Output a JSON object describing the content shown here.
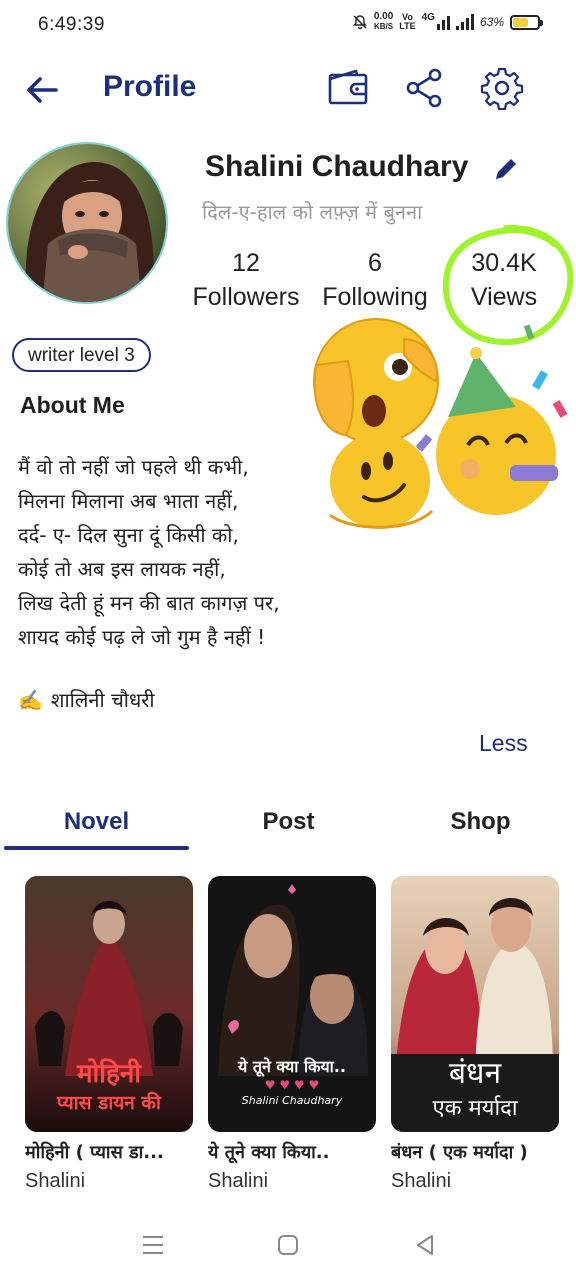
{
  "status_bar": {
    "time": "6:49:39",
    "net_speed_value": "0.00",
    "net_speed_unit": "KB/S",
    "volte_top": "Vo",
    "volte_bottom": "LTE",
    "network": "4G",
    "battery": "63%",
    "battery_level": 0.63
  },
  "header": {
    "title": "Profile",
    "back_icon": "arrow-left-icon",
    "wallet_icon": "wallet-icon",
    "share_icon": "share-icon",
    "settings_icon": "gear-icon"
  },
  "profile": {
    "name": "Shalini Chaudhary",
    "tagline": "दिल-ए-हाल को लफ़्ज़ में बुनना",
    "stats": [
      {
        "value": "12",
        "label": "Followers"
      },
      {
        "value": "6",
        "label": "Following"
      },
      {
        "value": "30.4K",
        "label": "Views"
      }
    ],
    "level": "writer level 3"
  },
  "about": {
    "title": "About Me",
    "lines": [
      "मैं वो तो नहीं जो पहले थी कभी,",
      "मिलना मिलाना अब भाता नहीं,",
      "दर्द- ए- दिल सुना दूं किसी को,",
      "कोई तो अब इस लायक नहीं,",
      "लिख देती हूं मन की बात कागज़ पर,",
      "शायद कोई पढ़ ले जो गुम है नहीं !"
    ],
    "signature_emoji": "✍️",
    "signature": "शालिनी चौधरी",
    "less_label": "Less"
  },
  "tabs": {
    "items": [
      "Novel",
      "Post",
      "Shop"
    ],
    "active": "Novel"
  },
  "books": [
    {
      "title": "मोहिनी ( प्यास डा...",
      "author": "Shalini",
      "cover_line1": "मोहिनी",
      "cover_line2": "प्यास डायन की"
    },
    {
      "title": "ये तूने क्या किया..",
      "author": "Shalini",
      "cover_line1": "ये तूने क्या किया..",
      "cover_line2": "Shalini Chaudhary"
    },
    {
      "title": "बंधन ( एक मर्यादा )",
      "author": "Shalini",
      "cover_line1": "बंधन",
      "cover_line2": "एक मर्यादा"
    }
  ],
  "colors": {
    "accent": "#1d2f7a",
    "highlight": "#9ef32a",
    "battery": "#f2cf3c"
  }
}
